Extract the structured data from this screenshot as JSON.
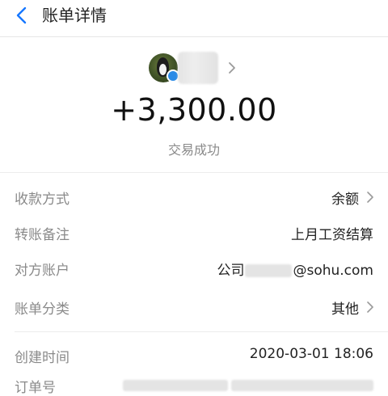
{
  "header": {
    "title": "账单详情",
    "back_icon": "chevron-left-icon",
    "accent": "#1677ff"
  },
  "counterparty": {
    "verified_badge_color": "#2b8be6"
  },
  "transaction": {
    "amount": "+3,300.00",
    "status": "交易成功"
  },
  "details": [
    {
      "label": "收款方式",
      "value": "余额",
      "has_chevron": true
    },
    {
      "label": "转账备注",
      "value": "上月工资结算",
      "has_chevron": false
    },
    {
      "label": "对方账户",
      "value_prefix": "公司",
      "value_suffix": "@sohu.com",
      "has_chevron": false
    },
    {
      "label": "账单分类",
      "value": "其他",
      "has_chevron": true
    },
    {
      "label": "创建时间",
      "value": "2020-03-01 18:06",
      "has_chevron": false
    },
    {
      "label": "订单号",
      "has_chevron": false
    }
  ]
}
